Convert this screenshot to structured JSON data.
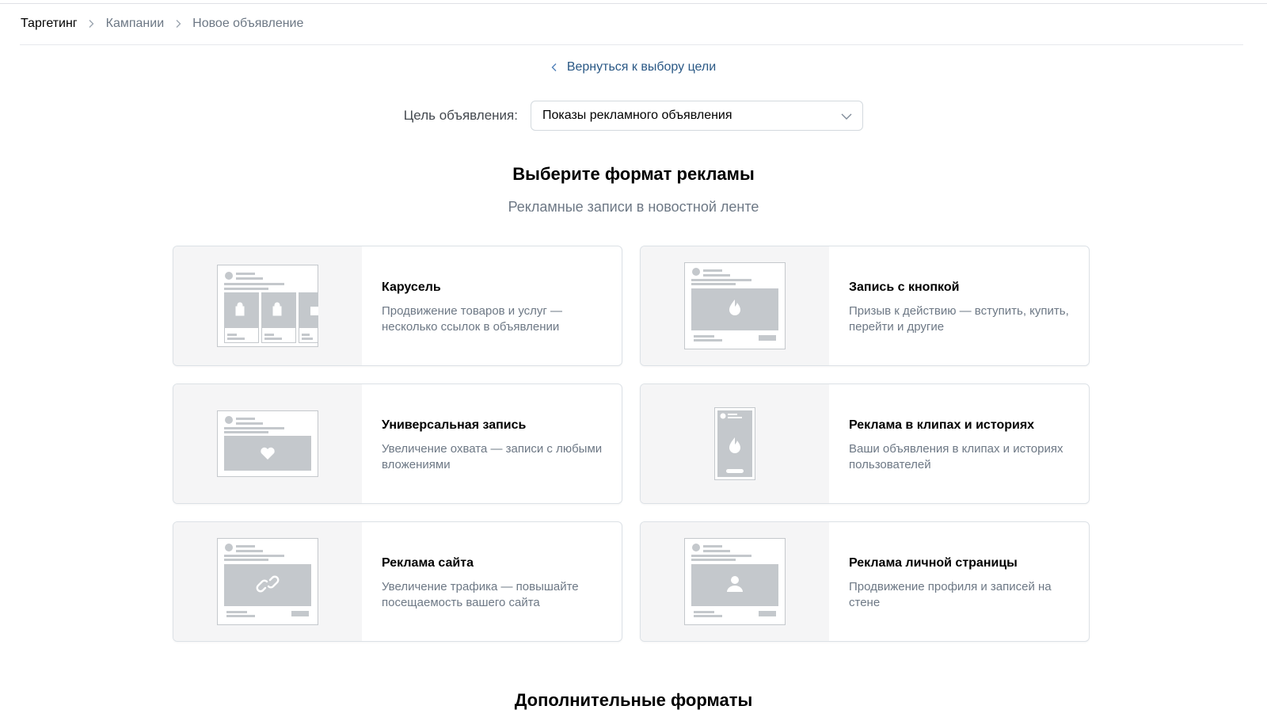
{
  "breadcrumb": {
    "items": [
      "Таргетинг",
      "Кампании",
      "Новое объявление"
    ]
  },
  "back_link": {
    "label": "Вернуться к выбору цели"
  },
  "goal": {
    "label": "Цель объявления:",
    "selected": "Показы рекламного объявления"
  },
  "section": {
    "title": "Выберите формат рекламы",
    "subtitle": "Рекламные записи в новостной ленте"
  },
  "formats": [
    {
      "title": "Карусель",
      "desc": "Продвижение товаров и услуг — несколько ссылок в объявлении",
      "icon": "carousel-icon"
    },
    {
      "title": "Запись с кнопкой",
      "desc": "Призыв к действию — вступить, купить, перейти и другие",
      "icon": "button-post-icon"
    },
    {
      "title": "Универсальная запись",
      "desc": "Увеличение охвата — записи с любыми вложениями",
      "icon": "universal-post-icon"
    },
    {
      "title": "Реклама в клипах и историях",
      "desc": "Ваши объявления в клипах и историях пользователей",
      "icon": "clips-stories-icon"
    },
    {
      "title": "Реклама сайта",
      "desc": "Увеличение трафика — повышайте посещаемость вашего сайта",
      "icon": "site-ad-icon"
    },
    {
      "title": "Реклама личной страницы",
      "desc": "Продвижение профиля и записей на стене",
      "icon": "personal-page-icon"
    }
  ],
  "more": {
    "title": "Дополнительные форматы"
  },
  "colors": {
    "link": "#2a5885",
    "muted": "#6d7885",
    "border": "#dce1e6",
    "thumb_bg": "#f5f5f6",
    "placeholder": "#c4c8cc"
  }
}
